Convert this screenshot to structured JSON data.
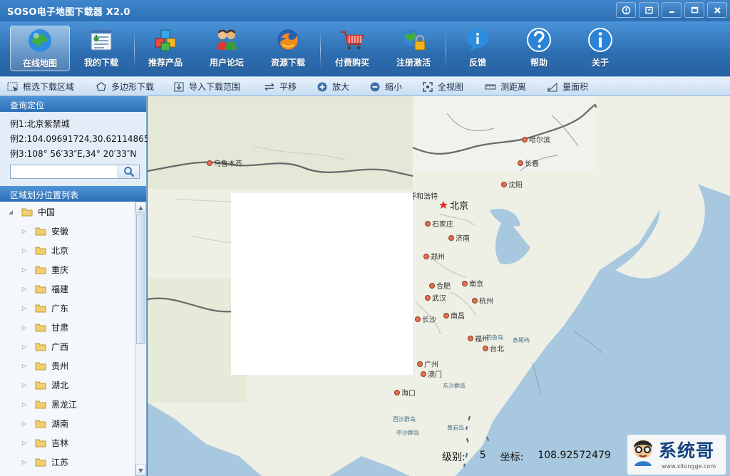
{
  "window": {
    "title": "SOSO电子地图下载器 X2.0",
    "controls": [
      "help-icon",
      "restore-tray-icon",
      "minimize-icon",
      "maximize-icon",
      "close-icon"
    ]
  },
  "toolbar": {
    "items": [
      {
        "label": "在线地图",
        "icon": "globe-icon",
        "active": true
      },
      {
        "label": "我的下载",
        "icon": "download-list-icon"
      },
      {
        "label": "推荐产品",
        "icon": "cubes-icon"
      },
      {
        "label": "用户论坛",
        "icon": "users-icon"
      },
      {
        "label": "资源下载",
        "icon": "firefox-icon"
      },
      {
        "label": "付费购买",
        "icon": "cart-icon"
      },
      {
        "label": "注册激活",
        "icon": "globe-lock-icon"
      },
      {
        "label": "反馈",
        "icon": "feedback-icon"
      },
      {
        "label": "帮助",
        "icon": "help-icon"
      },
      {
        "label": "关于",
        "icon": "info-icon"
      }
    ]
  },
  "subbar": {
    "items": [
      {
        "label": "框选下载区域",
        "icon": "select-area-icon"
      },
      {
        "label": "多边形下载",
        "icon": "polygon-icon"
      },
      {
        "label": "导入下载范围",
        "icon": "import-icon"
      },
      {
        "label": "平移",
        "icon": "pan-icon"
      },
      {
        "label": "放大",
        "icon": "zoom-in-icon"
      },
      {
        "label": "缩小",
        "icon": "zoom-out-icon"
      },
      {
        "label": "全视图",
        "icon": "full-view-icon"
      },
      {
        "label": "测距离",
        "icon": "ruler-icon"
      },
      {
        "label": "量面积",
        "icon": "area-icon"
      }
    ]
  },
  "query": {
    "header": "查询定位",
    "examples": [
      "例1:北京紫禁城",
      "例2:104.09691724,30.62114865",
      "例3:108° 56′33″E,34° 20′33″N"
    ],
    "search_value": "",
    "search_icon": "search-icon"
  },
  "tree": {
    "header": "区域划分位置列表",
    "root": "中国",
    "children": [
      "安徽",
      "北京",
      "重庆",
      "福建",
      "广东",
      "甘肃",
      "广西",
      "贵州",
      "湖北",
      "黑龙江",
      "湖南",
      "吉林",
      "江苏"
    ]
  },
  "map": {
    "capital": "北京",
    "cities": [
      "乌鲁木齐",
      "哈尔滨",
      "长春",
      "沈阳",
      "呼和浩特",
      "石家庄",
      "济南",
      "郑州",
      "合肥",
      "南京",
      "武汉",
      "杭州",
      "长沙",
      "南昌",
      "福州",
      "台北",
      "广州",
      "澳门",
      "海口"
    ],
    "sea_labels": [
      "钓鱼岛",
      "赤尾屿",
      "东沙群岛",
      "西沙群岛",
      "中沙群岛",
      "黄岩岛"
    ],
    "status": {
      "level_label": "级别:",
      "level_value": "5",
      "coord_label": "坐标:",
      "coord_value": "108.92572479"
    },
    "watermark": {
      "name": "系统哥",
      "url": "www.xitongge.com"
    }
  },
  "colors": {
    "titlebar": "#2d6fb4",
    "land": "#eef0e6",
    "sea": "#a8c8df",
    "city_dot": "#e46f4e"
  }
}
